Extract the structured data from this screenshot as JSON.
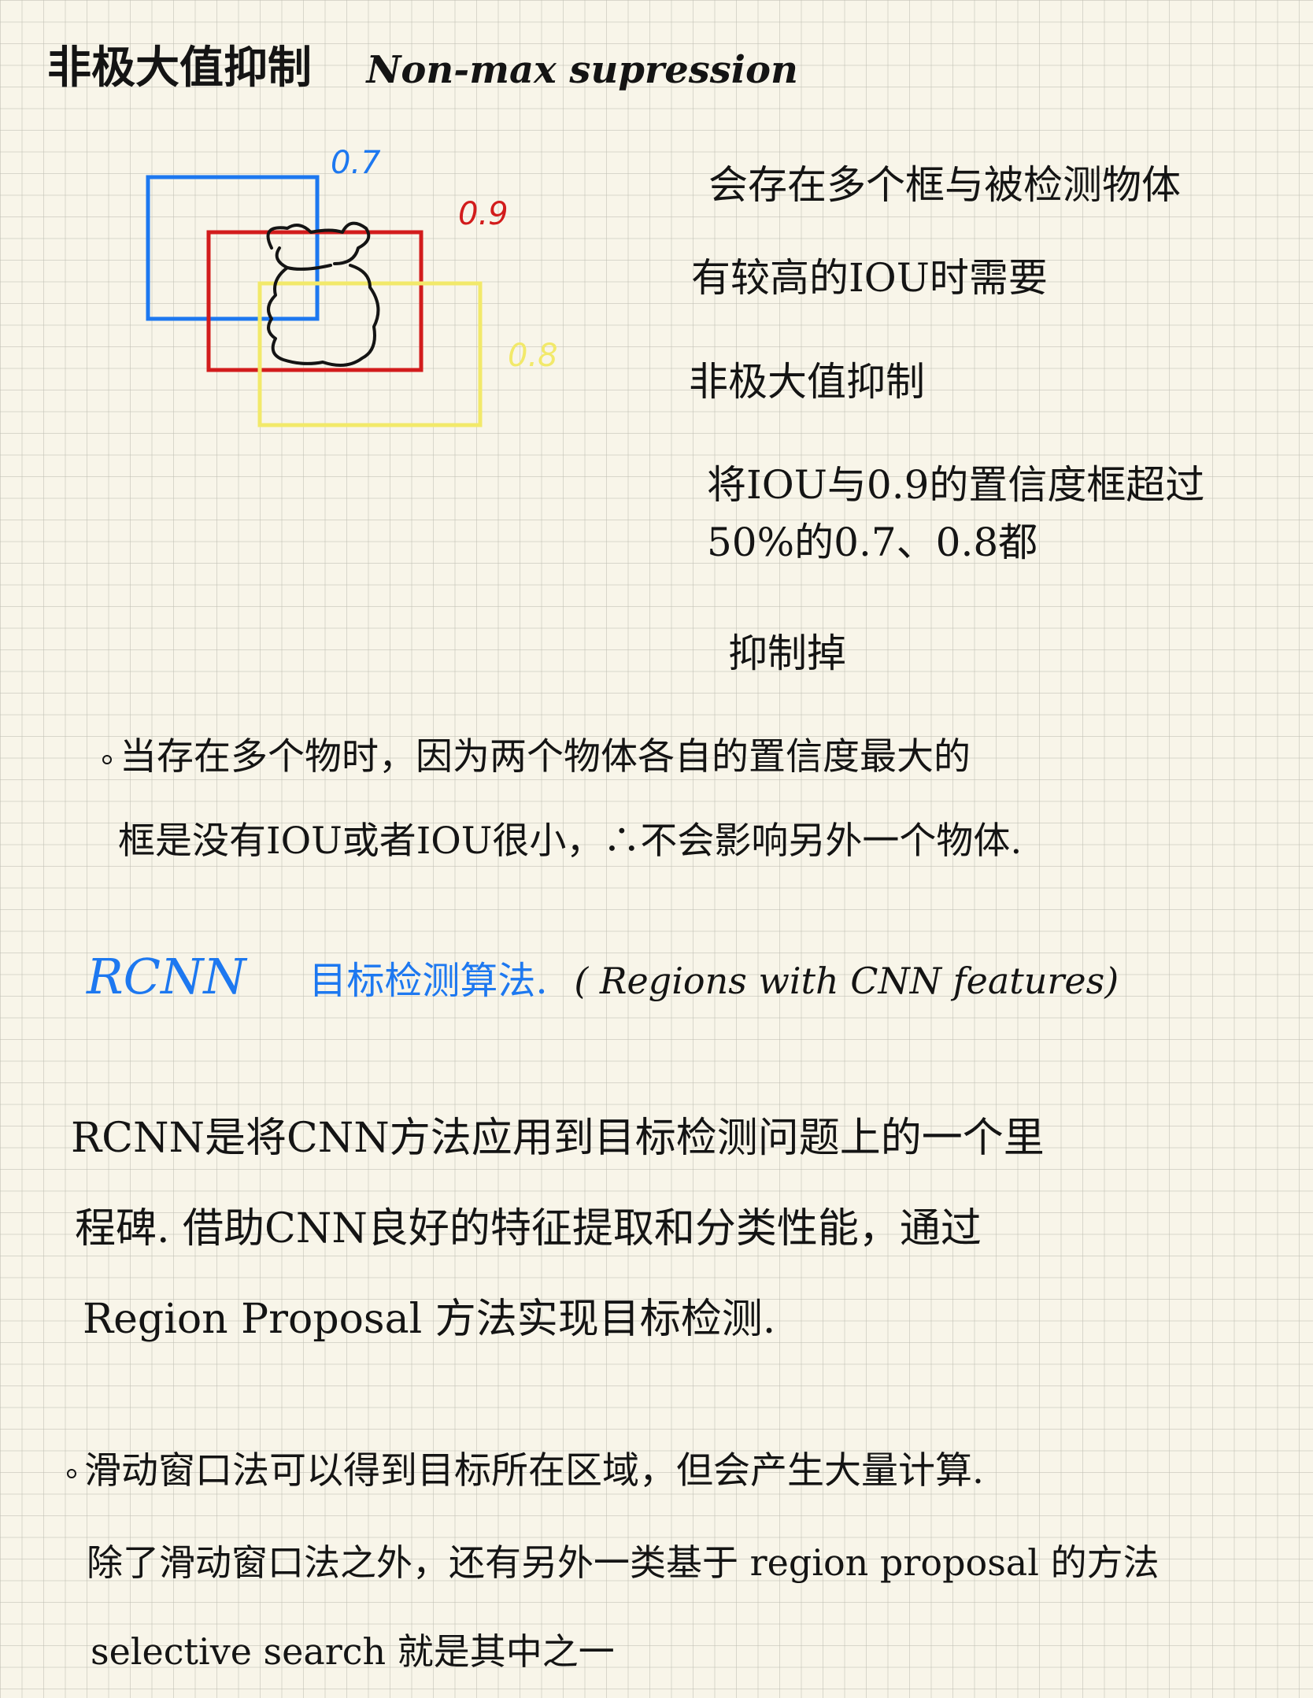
{
  "title": {
    "zh": "非极大值抑制",
    "en": "Non-max supression"
  },
  "figure": {
    "boxes": [
      {
        "score": "0.7",
        "color": "#1d78f0"
      },
      {
        "score": "0.9",
        "color": "#d21c1c"
      },
      {
        "score": "0.8",
        "color": "#f2e96a"
      }
    ],
    "object_color": "#141414"
  },
  "notes_right": [
    "会存在多个框与被检测物体",
    "有较高的IOU时需要",
    "非极大值抑制",
    "将IOU与0.9的置信度框超过50%的0.7、0.8都",
    "抑制掉"
  ],
  "note_multi": {
    "line1": "当存在多个物时，因为两个物体各自的置信度最大的",
    "line2": "框是没有IOU或者IOU很小，∴不会影响另外一个物体."
  },
  "rcnn_heading": {
    "name": "RCNN",
    "desc": "目标检测算法.",
    "paren": "( Regions with CNN features)"
  },
  "rcnn_para": [
    "RCNN是将CNN方法应用到目标检测问题上的一个里",
    "程碑. 借助CNN良好的特征提取和分类性能，通过",
    "Region Proposal 方法实现目标检测."
  ],
  "sliding_note": [
    "滑动窗口法可以得到目标所在区域，但会产生大量计算.",
    "除了滑动窗口法之外，还有另外一类基于 region proposal 的方法",
    "selective search 就是其中之一"
  ]
}
